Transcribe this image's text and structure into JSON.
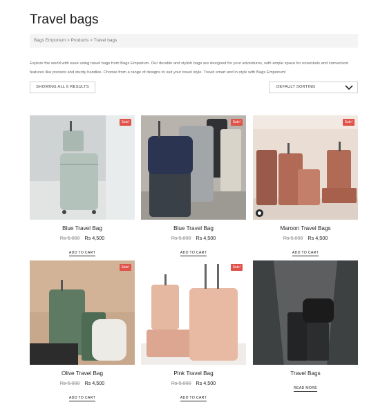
{
  "page": {
    "title": "Travel bags"
  },
  "breadcrumb": {
    "text": "Bags Emporium > Products > Travel bags"
  },
  "intro": {
    "text": "Explore the world with ease using travel bags from Bags Emporium. Our durable and stylish bags are designed for your adventures, with ample space for essentials and convenient features like pockets and sturdy handles. Choose from a range of designs to suit your travel style. Travel smart and in style with Bags Emporium!"
  },
  "toolbar": {
    "results_label": "SHOWING ALL 6 RESULTS",
    "sort_label": "DEFAULT SORTING"
  },
  "products": [
    {
      "name": "Blue Travel Bag",
      "old_price": "Rs 5,000",
      "price": "Rs 4,500",
      "badge": "Sale!",
      "cta": "ADD TO CART"
    },
    {
      "name": "Blue Travel Bag",
      "old_price": "Rs 5,000",
      "price": "Rs 4,500",
      "badge": "Sale!",
      "cta": "ADD TO CART"
    },
    {
      "name": "Maroon Travel Bags",
      "old_price": "Rs 5,000",
      "price": "Rs 4,500",
      "badge": "Sale!",
      "cta": "ADD TO CART"
    },
    {
      "name": "Olive Travel Bag",
      "old_price": "Rs 5,000",
      "price": "Rs 4,500",
      "badge": "Sale!",
      "cta": "ADD TO CART"
    },
    {
      "name": "Pink Travel Bag",
      "old_price": "Rs 5,000",
      "price": "Rs 4,500",
      "badge": "Sale!",
      "cta": "ADD TO CART"
    },
    {
      "name": "Travel Bags",
      "cta": "READ MORE"
    }
  ],
  "colors": {
    "sale_badge": "#e0524a",
    "text": "#222222",
    "muted": "#999999"
  }
}
